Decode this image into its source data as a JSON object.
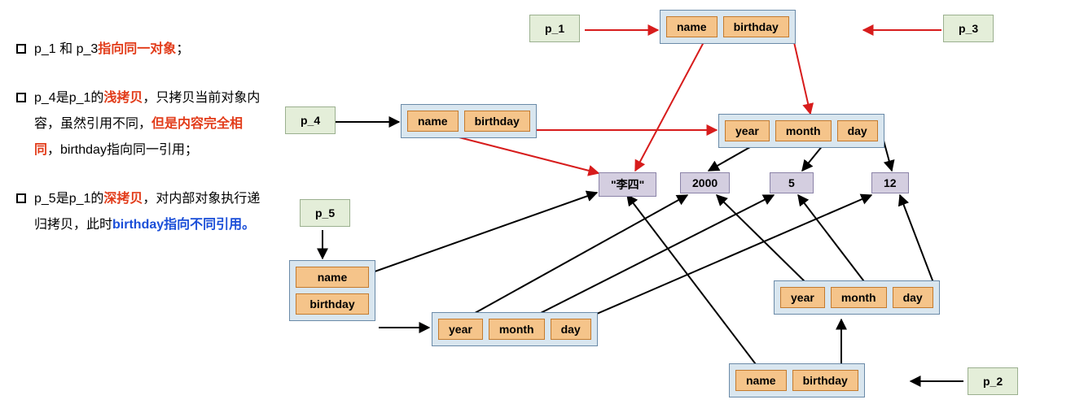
{
  "notes": {
    "b1": {
      "pre": "p_1 和 p_3",
      "hl": "指向同一对象",
      "post": "；"
    },
    "b2": {
      "pre": "p_4是p_1的",
      "hl": "浅拷贝",
      "mid": "，只拷贝当前对象内容，虽然引用不同，",
      "hl2": "但是内容完全相同",
      "post": "，birthday指向同一引用；"
    },
    "b3": {
      "pre": "p_5是p_1的",
      "hl": "深拷贝",
      "mid": "，对内部对象执行递归拷贝，此时",
      "hl2": "birthday指向不同引用。"
    }
  },
  "vars": {
    "p1": "p_1",
    "p2": "p_2",
    "p3": "p_3",
    "p4": "p_4",
    "p5": "p_5"
  },
  "fields": {
    "name": "name",
    "birthday": "birthday",
    "year": "year",
    "month": "month",
    "day": "day"
  },
  "values": {
    "lisi": "\"李四\"",
    "y": "2000",
    "m": "5",
    "d": "12"
  }
}
